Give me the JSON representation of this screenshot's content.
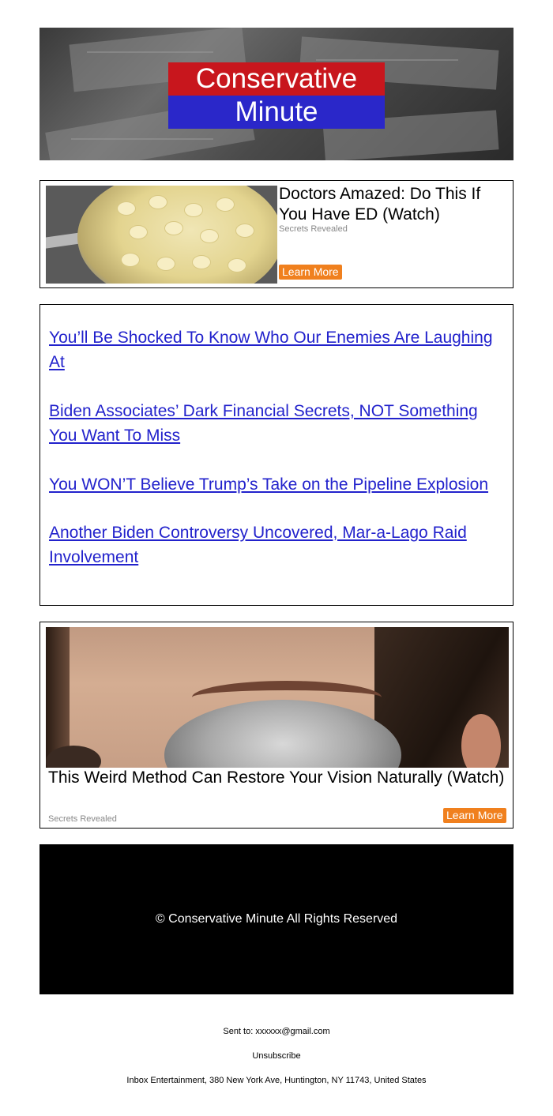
{
  "header": {
    "logo_line1": "Conservative",
    "logo_line2": "Minute"
  },
  "ad_top": {
    "title": "Doctors Amazed: Do This If You Have ED (Watch)",
    "source": "Secrets Revealed",
    "button_label": "Learn More"
  },
  "links": [
    {
      "text": "You’ll Be Shocked To Know Who Our Enemies Are Laughing At"
    },
    {
      "text": "Biden Associates’ Dark Financial Secrets, NOT Something You Want To Miss"
    },
    {
      "text": "You WON’T Believe Trump’s Take on the Pipeline Explosion"
    },
    {
      "text": "Another Biden Controversy Uncovered, Mar-a-Lago Raid Involvement"
    }
  ],
  "ad_bottom": {
    "title": "This Weird Method Can Restore Your Vision Naturally (Watch)",
    "source": "Secrets Revealed",
    "button_label": "Learn More"
  },
  "copyright": "© Conservative Minute All Rights Reserved",
  "footer": {
    "sent_to": "Sent to: xxxxxx@gmail.com",
    "unsubscribe": "Unsubscribe",
    "address": "Inbox Entertainment, 380 New York Ave, Huntington, NY 11743, United States"
  },
  "colors": {
    "logo_red": "#c8161d",
    "logo_blue": "#2a27c9",
    "link_blue": "#2222cc",
    "button_orange": "#f0801e"
  }
}
